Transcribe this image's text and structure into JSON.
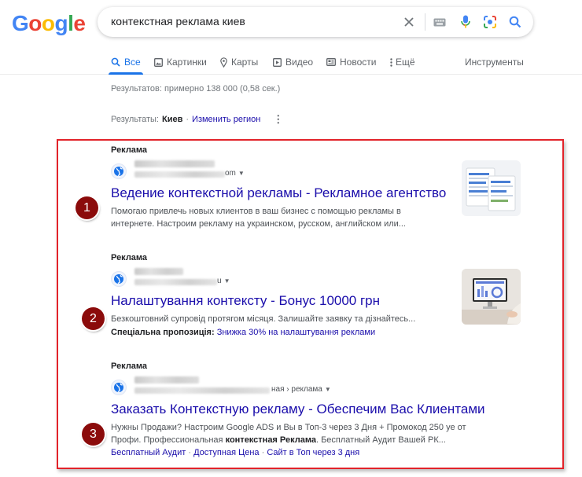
{
  "logo": {
    "letters": [
      "G",
      "o",
      "o",
      "g",
      "l",
      "e"
    ]
  },
  "search": {
    "query": "контекстная реклама киев"
  },
  "tabs": [
    {
      "label": "Все",
      "icon": "search-icon"
    },
    {
      "label": "Картинки",
      "icon": "image-icon"
    },
    {
      "label": "Карты",
      "icon": "map-pin-icon"
    },
    {
      "label": "Видео",
      "icon": "video-icon"
    },
    {
      "label": "Новости",
      "icon": "news-icon"
    },
    {
      "label": "Ещё",
      "icon": "more-vert-icon"
    }
  ],
  "tools_label": "Инструменты",
  "stats": "Результатов: примерно 138 000 (0,58 сек.)",
  "region": {
    "prefix": "Результаты:",
    "city": "Киев",
    "sep": "·",
    "change": "Изменить регион"
  },
  "ads": [
    {
      "label": "Реклама",
      "source_tail": "om",
      "title": "Ведение контекстной рекламы - Рекламное агентство",
      "desc": "Помогаю привлечь новых клиентов в ваш бизнес с помощью рекламы в интернете. Настроим рекламу на украинском, русском, английском или...",
      "marker": "1"
    },
    {
      "label": "Реклама",
      "source_tail": "u",
      "title": "Налаштування контексту - Бонус 10000 грн",
      "desc": "Безкоштовний супровід протягом місяця. Залишайте заявку та дізнайтесь...",
      "promo_label": "Спеціальна пропозиція:",
      "promo_link": "Знижка 30% на налаштування реклами",
      "marker": "2"
    },
    {
      "label": "Реклама",
      "source_tail": "ная › реклама",
      "title": "Заказать Контекстную рекламу - Обеспечим Вас Клиентами",
      "desc_a": "Нужны Продажи? Настроим Google ADS и Вы в Топ-3 через 3 Дня + Промокод 250 уе от Профи. Профессиональная ",
      "desc_bold": "контекстная Реклама",
      "desc_b": ". Бесплатный Аудит Вашей РК...",
      "links": [
        "Бесплатный Аудит",
        "Доступная Цена",
        "Сайт в Топ через 3 дня"
      ],
      "link_sep": "·",
      "marker": "3"
    }
  ],
  "colors": {
    "link": "#1a0dab",
    "accent": "#1a73e8",
    "highlight_box": "#e2232a",
    "marker": "#8b0b0b"
  }
}
